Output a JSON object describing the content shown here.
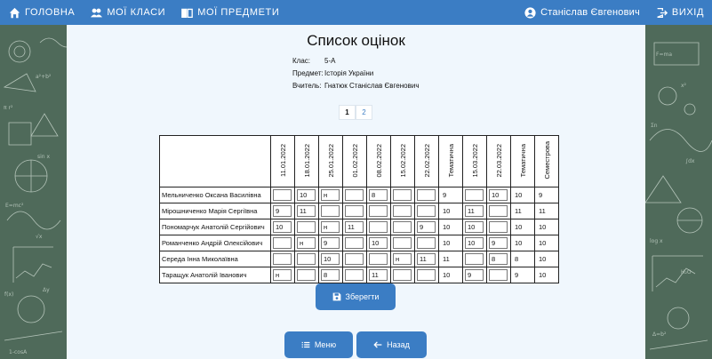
{
  "nav": {
    "home": "ГОЛОВНА",
    "my_classes": "МОЇ КЛАСИ",
    "my_subjects": "МОЇ ПРЕДМЕТИ",
    "user": "Станіслав Євгенович",
    "logout": "ВИХІД"
  },
  "page": {
    "title": "Список оцінок",
    "meta": [
      {
        "key": "Клас:",
        "value": "5-А"
      },
      {
        "key": "Предмет:",
        "value": "Історія України"
      },
      {
        "key": "Вчитель:",
        "value": "Гнатюк Станіслав Євгенович"
      }
    ],
    "pages": [
      "1",
      "2"
    ],
    "current_page": "1"
  },
  "table": {
    "columns": [
      "11.01.2022",
      "18.01.2022",
      "25.01.2022",
      "01.02.2022",
      "08.02.2022",
      "15.02.2022",
      "22.02.2022",
      "Тематична",
      "15.03.2022",
      "22.03.2022",
      "Тематична",
      "Семестрова"
    ],
    "rows": [
      {
        "name": "Мельниченко Оксана Василівна",
        "grades": [
          "",
          "10",
          "н",
          "",
          "8",
          "",
          "",
          "9",
          "",
          "10",
          "10",
          "9"
        ]
      },
      {
        "name": "Мірошниченко Марія Сергіївна",
        "grades": [
          "9",
          "11",
          "",
          "",
          "",
          "",
          "",
          "10",
          "11",
          "",
          "11",
          "11"
        ]
      },
      {
        "name": "Пономарчук Анатолій Сергійович",
        "grades": [
          "10",
          "",
          "н",
          "11",
          "",
          "",
          "9",
          "10",
          "10",
          "",
          "10",
          "10"
        ]
      },
      {
        "name": "Романченко Андрій Олексійович",
        "grades": [
          "",
          "н",
          "9",
          "",
          "10",
          "",
          "",
          "10",
          "10",
          "9",
          "10",
          "10"
        ]
      },
      {
        "name": "Середа Інна Миколаївна",
        "grades": [
          "",
          "",
          "10",
          "",
          "",
          "н",
          "11",
          "11",
          "",
          "8",
          "8",
          "10"
        ]
      },
      {
        "name": "Таращук Анатолій Іванович",
        "grades": [
          "н",
          "",
          "8",
          "",
          "11",
          "",
          "",
          "10",
          "9",
          "",
          "9",
          "10"
        ]
      }
    ],
    "static_columns": [
      7,
      10,
      11
    ]
  },
  "buttons": {
    "save": "Зберегти",
    "menu": "Меню",
    "back": "Назад"
  },
  "colors": {
    "accent": "#3b7dc4",
    "panel": "#f0f7fd",
    "chalkboard": "#4f6a5a"
  }
}
